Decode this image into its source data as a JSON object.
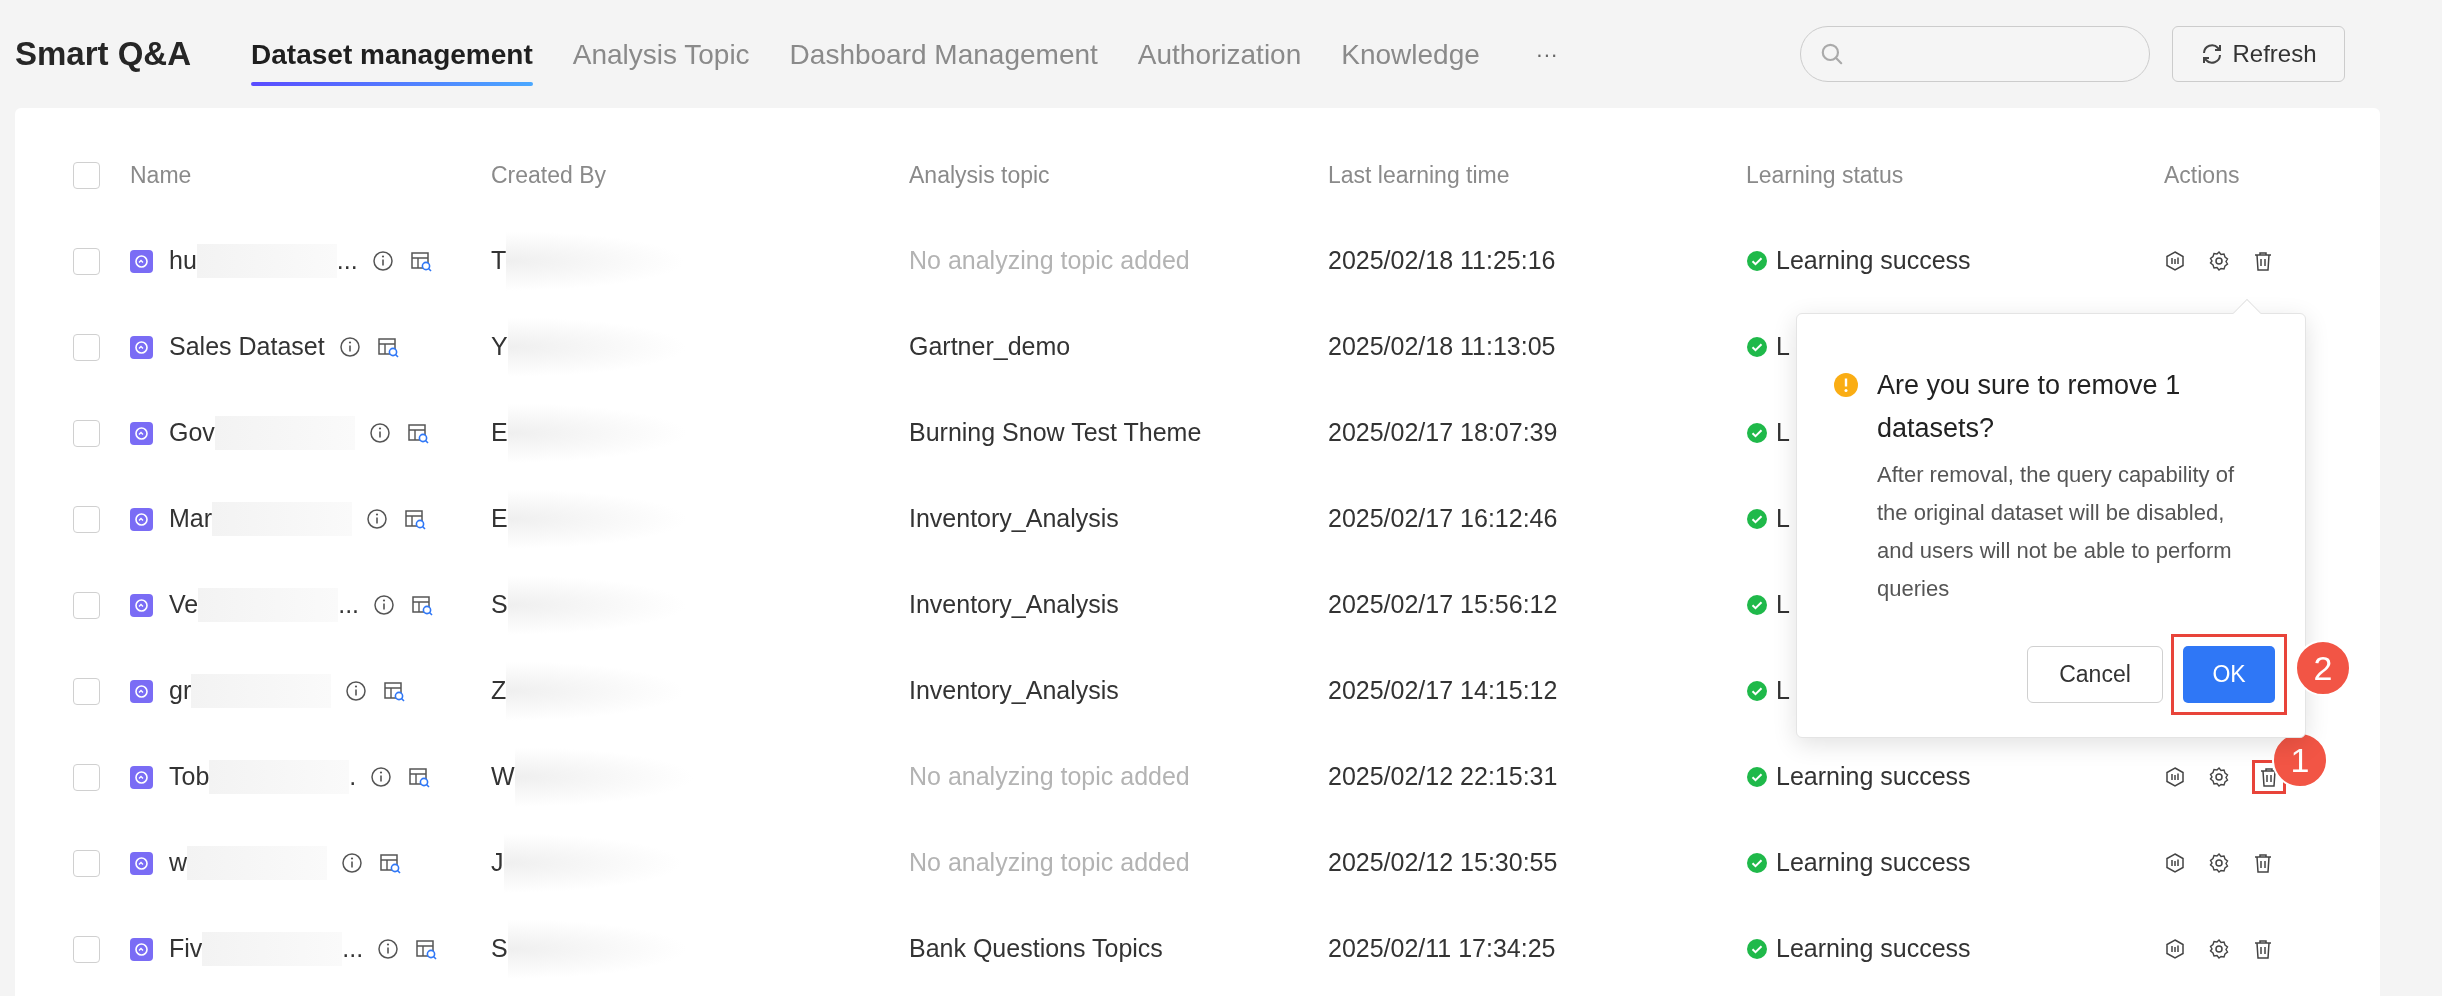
{
  "app_title": "Smart Q&A",
  "tabs": [
    {
      "label": "Dataset management",
      "selected": true
    },
    {
      "label": "Analysis Topic",
      "selected": false
    },
    {
      "label": "Dashboard Management",
      "selected": false
    },
    {
      "label": "Authorization",
      "selected": false
    },
    {
      "label": "Knowledge",
      "selected": false
    }
  ],
  "more_tabs": "···",
  "refresh_button": "Refresh",
  "table": {
    "columns": [
      "Name",
      "Created By",
      "Analysis topic",
      "Last learning time",
      "Learning status",
      "Actions"
    ],
    "select_all_checked": false,
    "rows": [
      {
        "checked": false,
        "name": "hu",
        "redacted": true,
        "tail": "...",
        "created_by": "T",
        "topic": "No analyzing topic added",
        "topic_empty": true,
        "time": "2025/02/18 11:25:16",
        "status": "Learning success",
        "show_actions": true,
        "delete_highlighted": false
      },
      {
        "checked": false,
        "name": "Sales Dataset",
        "redacted": false,
        "created_by": "Y",
        "topic": "Gartner_demo",
        "topic_empty": false,
        "time": "2025/02/18 11:13:05",
        "status": "L",
        "show_actions": false,
        "delete_highlighted": false
      },
      {
        "checked": false,
        "name": "Gov",
        "redacted": true,
        "created_by": "E",
        "topic": "Burning Snow Test Theme",
        "topic_empty": false,
        "time": "2025/02/17 18:07:39",
        "status": "L",
        "show_actions": false,
        "delete_highlighted": false
      },
      {
        "checked": false,
        "name": "Mar",
        "redacted": true,
        "created_by": "E",
        "topic": "Inventory_Analysis",
        "topic_empty": false,
        "time": "2025/02/17 16:12:46",
        "status": "L",
        "show_actions": false,
        "delete_highlighted": false
      },
      {
        "checked": false,
        "name": "Ve",
        "redacted": true,
        "tail": "...",
        "created_by": "S",
        "topic": "Inventory_Analysis",
        "topic_empty": false,
        "time": "2025/02/17 15:56:12",
        "status": "L",
        "show_actions": false,
        "delete_highlighted": false
      },
      {
        "checked": false,
        "name": "gr",
        "redacted": true,
        "created_by": "Z",
        "topic": "Inventory_Analysis",
        "topic_empty": false,
        "time": "2025/02/17 14:15:12",
        "status": "L",
        "show_actions": false,
        "delete_highlighted": false
      },
      {
        "checked": false,
        "name": "Tob",
        "redacted": true,
        "tail": ".",
        "created_by": "W",
        "topic": "No analyzing topic added",
        "topic_empty": true,
        "time": "2025/02/12 22:15:31",
        "status": "Learning success",
        "show_actions": true,
        "delete_highlighted": true,
        "callout": "1"
      },
      {
        "checked": false,
        "name": "w",
        "redacted": true,
        "created_by": "J",
        "topic": "No analyzing topic added",
        "topic_empty": true,
        "time": "2025/02/12 15:30:55",
        "status": "Learning success",
        "show_actions": true,
        "delete_highlighted": false
      },
      {
        "checked": false,
        "name": "Fiv",
        "redacted": true,
        "tail": "...",
        "created_by": "S",
        "topic": "Bank Questions Topics",
        "topic_empty": false,
        "time": "2025/02/11 17:34:25",
        "status": "Learning success",
        "show_actions": true,
        "delete_highlighted": false
      }
    ]
  },
  "popconfirm": {
    "title": "Are you sure to remove 1 datasets?",
    "message": "After removal, the query capability of the original dataset will be disabled, and users will not be able to perform queries",
    "cancel": "Cancel",
    "ok": "OK",
    "ok_highlighted": true,
    "ok_callout": "2"
  }
}
